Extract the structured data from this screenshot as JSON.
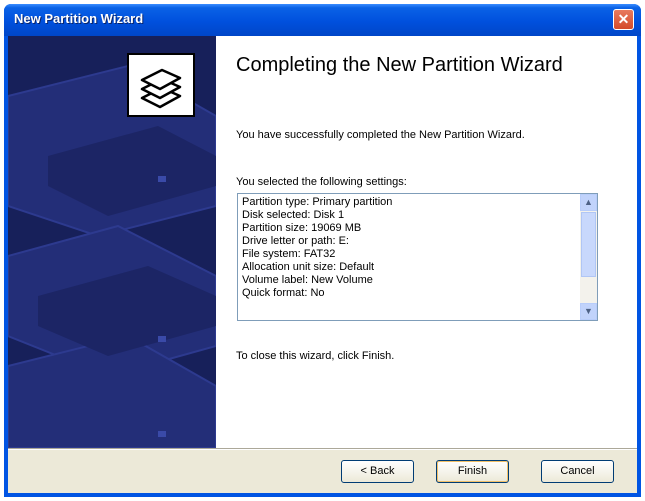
{
  "window": {
    "title": "New Partition Wizard",
    "close_glyph": "✕"
  },
  "main": {
    "heading": "Completing the New Partition Wizard",
    "completed_text": "You have successfully completed the New Partition Wizard.",
    "settings_label": "You selected the following settings:",
    "settings": [
      "Partition type: Primary partition",
      "Disk selected: Disk 1",
      "Partition size: 19069 MB",
      "Drive letter or path: E:",
      "File system: FAT32",
      "Allocation unit size: Default",
      "Volume label: New Volume",
      "Quick format: No"
    ],
    "close_hint": "To close this wizard, click Finish."
  },
  "buttons": {
    "back": "< Back",
    "finish": "Finish",
    "cancel": "Cancel"
  },
  "colors": {
    "titlebar": "#0054e3",
    "side_panel": "#17205a",
    "dialog_bg": "#ece9d8"
  },
  "icons": {
    "wizard": "stacked-disks-icon",
    "scroll_up": "arrow-up-icon",
    "scroll_down": "arrow-down-icon"
  }
}
